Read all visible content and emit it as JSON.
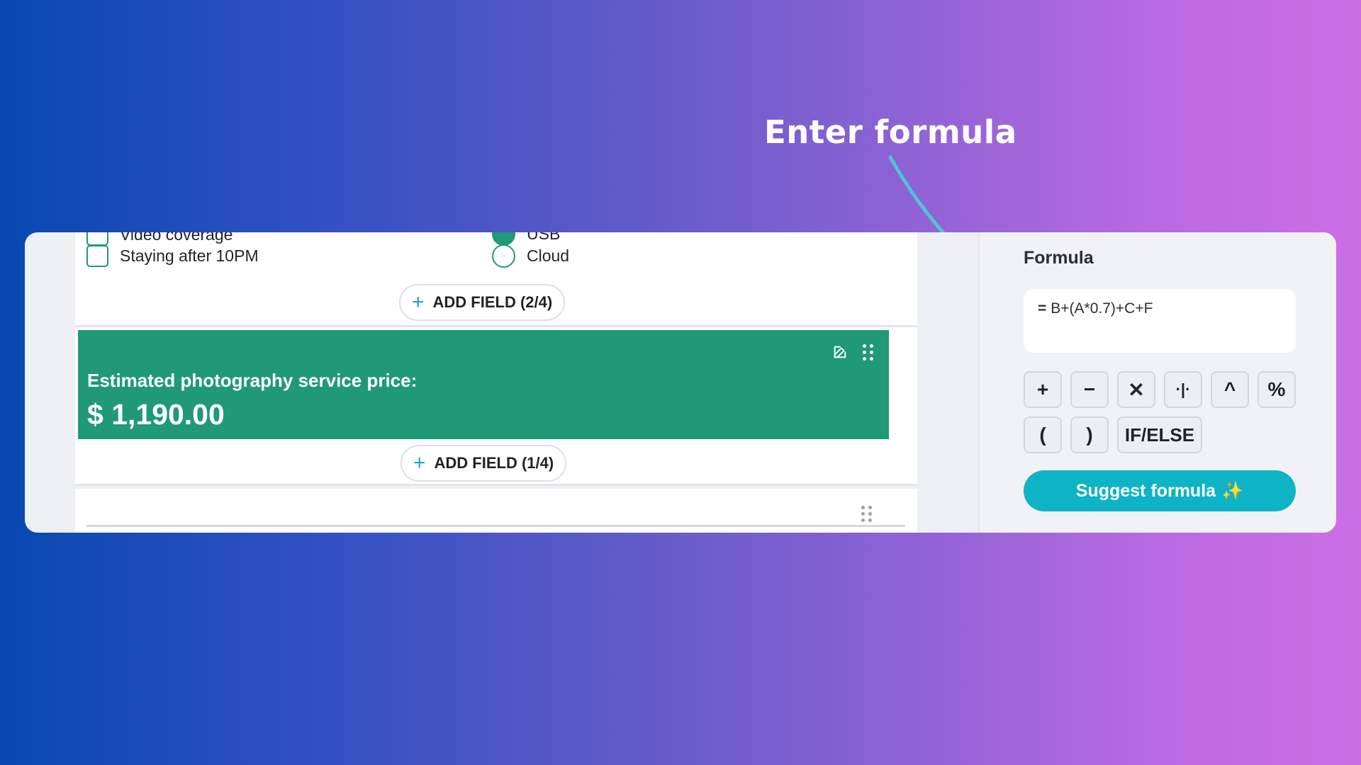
{
  "headline": "Enter formula",
  "builder": {
    "cut_checkbox_label": "Video coverage",
    "checkbox_label": "Staying after 10PM",
    "cut_radio_label": "USB",
    "radio_label": "Cloud",
    "add_field_1": "ADD FIELD (2/4)",
    "add_field_2": "ADD FIELD (1/4)",
    "price_label": "Estimated photography service price:",
    "price_value": "$ 1,190.00"
  },
  "formula_panel": {
    "title": "Formula",
    "eq_sign": "=",
    "expression": "B+(A*0.7)+C+F",
    "operators": {
      "plus": "+",
      "minus": "−",
      "multiply": "✕",
      "divide": "·|·",
      "power": "^",
      "percent": "%",
      "open_paren": "(",
      "close_paren": ")",
      "if_else": "IF/ELSE"
    },
    "suggest_label": "Suggest formula",
    "suggest_icon": "✨"
  },
  "colors": {
    "accent_green": "#1f9a75",
    "accent_cyan": "#0fb3c6",
    "arrow": "#4fc3d6"
  }
}
